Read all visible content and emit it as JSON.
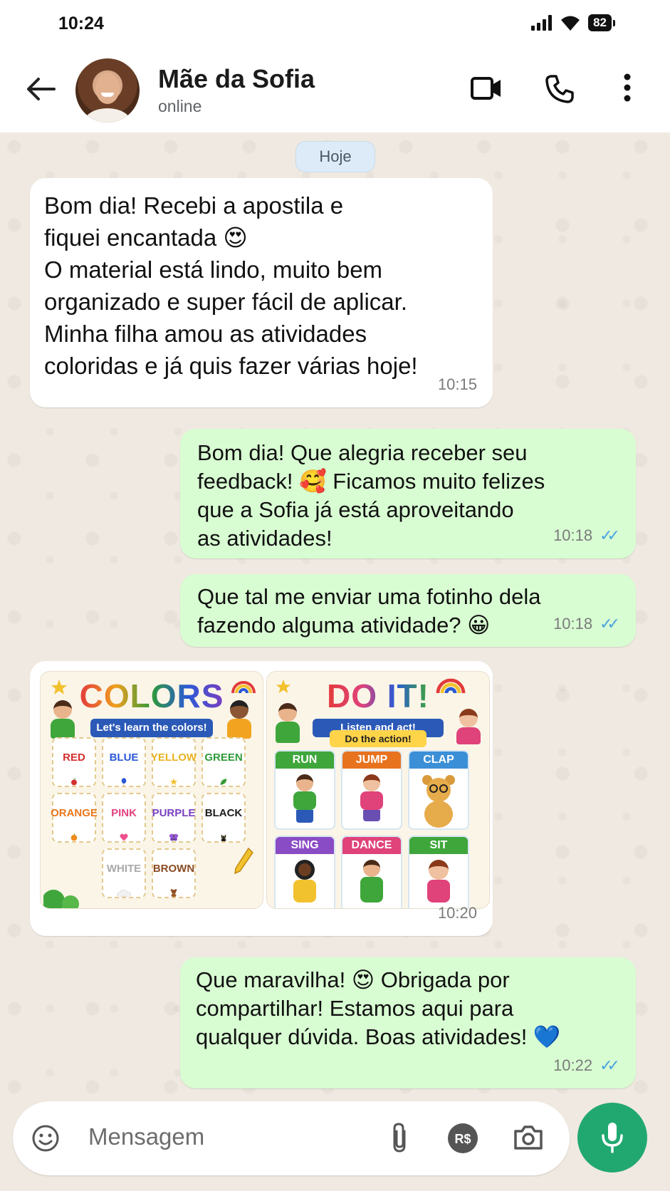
{
  "status_bar": {
    "time": "10:24",
    "battery": "82"
  },
  "header": {
    "contact_name": "Mãe da Sofia",
    "contact_status": "online"
  },
  "chat": {
    "date_divider": "Hoje",
    "messages": [
      {
        "direction": "in",
        "text": "Bom dia! Recebi a apostila e\nfiquei encantada 😍\nO material está lindo, muito bem\norganizado e super fácil de aplicar.\nMinha filha amou as atividades\ncoloridas e já quis fazer várias hoje!",
        "time": "10:15"
      },
      {
        "direction": "out",
        "text": "Bom dia! Que alegria receber seu\nfeedback! 🥰 Ficamos muito felizes\nque a Sofia já está aproveitando\nas atividades!",
        "time": "10:18",
        "read": true
      },
      {
        "direction": "out",
        "text": "Que tal me enviar uma fotinho dela\nfazendo alguma atividade? 😀",
        "time": "10:18",
        "read": true
      },
      {
        "direction": "in",
        "type": "images",
        "time": "10:20"
      },
      {
        "direction": "out",
        "text": "Que maravilha! 😍 Obrigada por\ncompartilhar! Estamos aqui para\nqualquer dúvida. Boas atividades! 💙",
        "time": "10:22",
        "read": true
      }
    ],
    "read_receipt_color": "#4aa3e0"
  },
  "image_colors": {
    "title": "COLORS",
    "subtitle": "Let's learn the colors!",
    "cells": [
      {
        "label": "RED",
        "color": "#d62e2e",
        "icon": "apple-icon"
      },
      {
        "label": "BLUE",
        "color": "#2b59d6",
        "icon": "balloon-icon"
      },
      {
        "label": "YELLOW",
        "color": "#e7b320",
        "icon": "star-icon"
      },
      {
        "label": "GREEN",
        "color": "#2f9a3a",
        "icon": "leaf-icon"
      },
      {
        "label": "ORANGE",
        "color": "#e9761c",
        "icon": "orange-icon"
      },
      {
        "label": "PINK",
        "color": "#e2427f",
        "icon": "heart-icon"
      },
      {
        "label": "PURPLE",
        "color": "#7a3fc0",
        "icon": "butterfly-icon"
      },
      {
        "label": "BLACK",
        "color": "#1b1b1b",
        "icon": "cat-icon"
      },
      {
        "label": "WHITE",
        "color": "#a9a9a9",
        "icon": "cloud-icon"
      },
      {
        "label": "BROWN",
        "color": "#8a4b21",
        "icon": "bear-icon"
      }
    ]
  },
  "image_actions": {
    "title": "DO IT!",
    "subtitle": "Listen and act!",
    "tagline": "Do the action!",
    "cells": [
      {
        "label": "RUN",
        "color": "#3fa63b"
      },
      {
        "label": "JUMP",
        "color": "#e8731f"
      },
      {
        "label": "CLAP",
        "color": "#3b8fd6"
      },
      {
        "label": "SING",
        "color": "#8a4cc4"
      },
      {
        "label": "DANCE",
        "color": "#e0427a"
      },
      {
        "label": "SIT",
        "color": "#3fa63b"
      }
    ]
  },
  "input_bar": {
    "placeholder": "Mensagem",
    "accent": "#21a871"
  }
}
